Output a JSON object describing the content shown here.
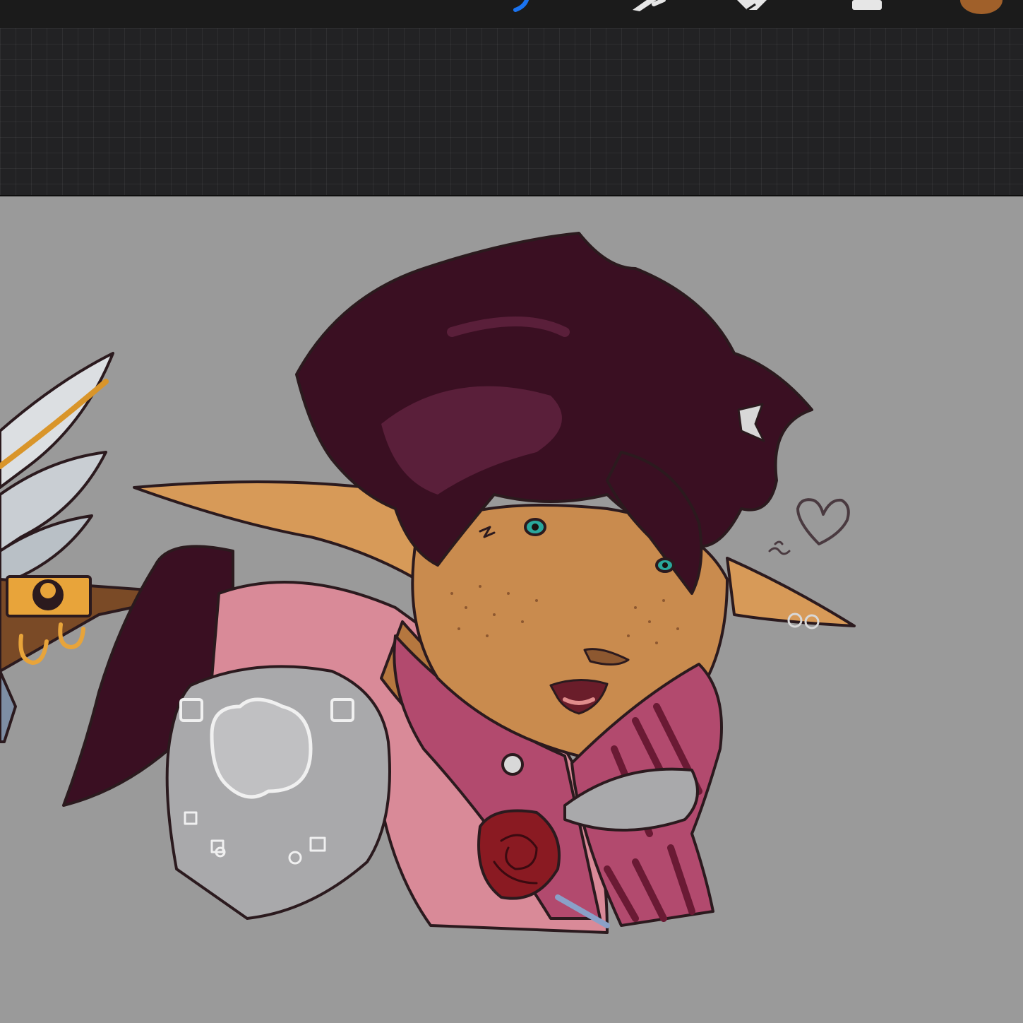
{
  "app": {
    "toolbar": {
      "tools": [
        {
          "icon": "brush-icon",
          "state": "active",
          "accent": "#1a73f0"
        },
        {
          "icon": "smudge-icon",
          "state": "idle"
        },
        {
          "icon": "eraser-icon",
          "state": "idle"
        },
        {
          "icon": "layers-icon",
          "state": "idle"
        },
        {
          "icon": "color-swatch-icon",
          "state": "idle",
          "color": "#a0602a"
        }
      ]
    },
    "canvas": {
      "background": "#9a9a9a",
      "artwork": "elf-character-bust",
      "palette": {
        "hair": "#3a0f22",
        "hair_highlight": "#5a1f3a",
        "skin": "#c98b4e",
        "ear": "#d79a58",
        "hoodie": "#d98a98",
        "shirt": "#b24a6e",
        "armor": "#a9a9ab",
        "rose": "#8a1a22",
        "eyes": "#2aa79c",
        "outline": "#2b1a1e"
      }
    }
  }
}
